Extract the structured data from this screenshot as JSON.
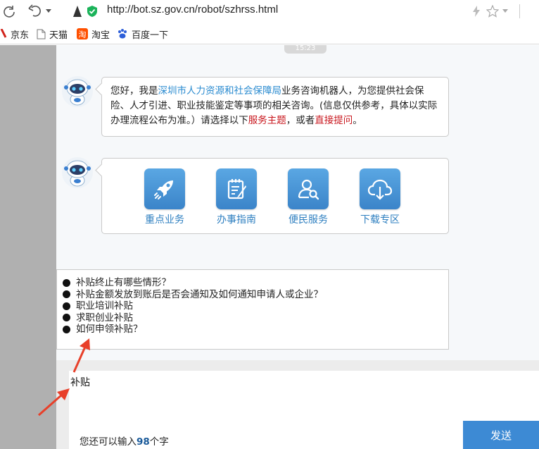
{
  "browser": {
    "url": "http://bot.sz.gov.cn/robot/szhrss.html",
    "bookmarks": [
      {
        "label": "京东",
        "icon": "jd-icon"
      },
      {
        "label": "天猫",
        "icon": "page-icon"
      },
      {
        "label": "淘宝",
        "icon": "taobao-icon"
      },
      {
        "label": "百度一下",
        "icon": "baidu-paw-icon"
      }
    ]
  },
  "chat": {
    "time": "15:23",
    "greeting": {
      "part1": "您好，我是",
      "link1": "深圳市人力资源和社会保障局",
      "part2": "业务咨询机器人，为您提供社会保险、人才引进、职业技能鉴定等事项的相关咨询。(信息仅供参考，具体以实际办理流程公布为准。）请选择以下",
      "link2": "服务主题",
      "part3": "，或者",
      "link3": "直接提问",
      "part4": "。"
    },
    "services": [
      {
        "label": "重点业务",
        "icon": "rocket-icon"
      },
      {
        "label": "办事指南",
        "icon": "clipboard-icon"
      },
      {
        "label": "便民服务",
        "icon": "user-search-icon"
      },
      {
        "label": "下载专区",
        "icon": "cloud-download-icon"
      }
    ]
  },
  "suggestions": [
    "补贴终止有哪些情形？",
    "补贴金额发放到账后是否会通知及如何通知申请人或企业？",
    "职业培训补贴",
    "求职创业补贴",
    "如何申领补贴？"
  ],
  "input": {
    "value": "补贴",
    "counter_prefix": "您还可以输入",
    "counter_value": "98",
    "counter_suffix": "个字",
    "send_label": "发送"
  },
  "colors": {
    "accent": "#3d8ad4",
    "link_blue": "#2a8bd0",
    "link_red": "#c8161d",
    "annotation_arrow": "#e8402a"
  }
}
